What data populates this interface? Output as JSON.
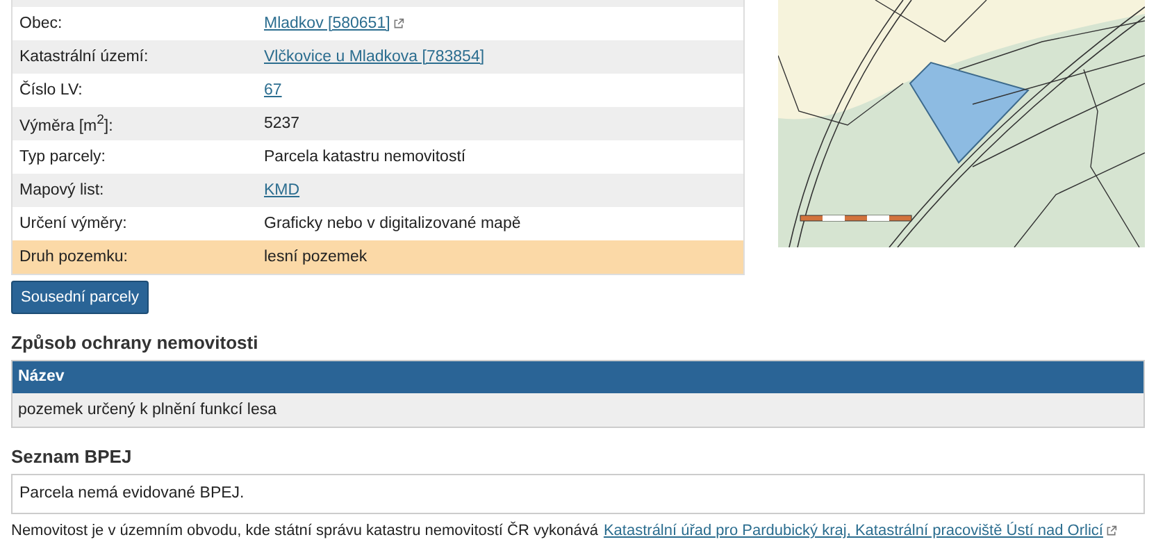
{
  "parcel_table": {
    "rows": [
      {
        "label": "Obec:",
        "value": "Mladkov [580651]",
        "kind": "link",
        "external": true,
        "highlighted": false
      },
      {
        "label": "Katastrální území:",
        "value": "Vlčkovice u Mladkova [783854]",
        "kind": "link",
        "external": false,
        "highlighted": false
      },
      {
        "label": "Číslo LV:",
        "value": "67",
        "kind": "link",
        "external": false,
        "highlighted": false
      },
      {
        "label": "Výměra [m$^{2}$]:",
        "value": "5237",
        "kind": "text",
        "external": false,
        "highlighted": false
      },
      {
        "label": "Typ parcely:",
        "value": "Parcela katastru nemovitostí",
        "kind": "text",
        "external": false,
        "highlighted": false
      },
      {
        "label": "Mapový list:",
        "value": "KMD",
        "kind": "link",
        "external": false,
        "highlighted": false
      },
      {
        "label": "Určení výměry:",
        "value": "Graficky nebo v digitalizované mapě",
        "kind": "text",
        "external": false,
        "highlighted": false
      },
      {
        "label": "Druh pozemku:",
        "value": "lesní pozemek",
        "kind": "text",
        "external": false,
        "highlighted": true
      }
    ]
  },
  "neighbors_button": "Sousední parcely",
  "protection": {
    "heading": "Způsob ochrany nemovitosti",
    "columns": [
      "Název"
    ],
    "rows": [
      "pozemek určený k plnění funkcí lesa"
    ]
  },
  "bpej": {
    "heading": "Seznam BPEJ",
    "text": "Parcela nemá evidované BPEJ."
  },
  "footer": {
    "text": "Nemovitost je v územním obvodu, kde státní správu katastru nemovitostí ČR vykonává",
    "link": "Katastrální úřad pro Pardubický kraj, Katastrální pracoviště Ústí nad Orlicí",
    "external": true
  }
}
